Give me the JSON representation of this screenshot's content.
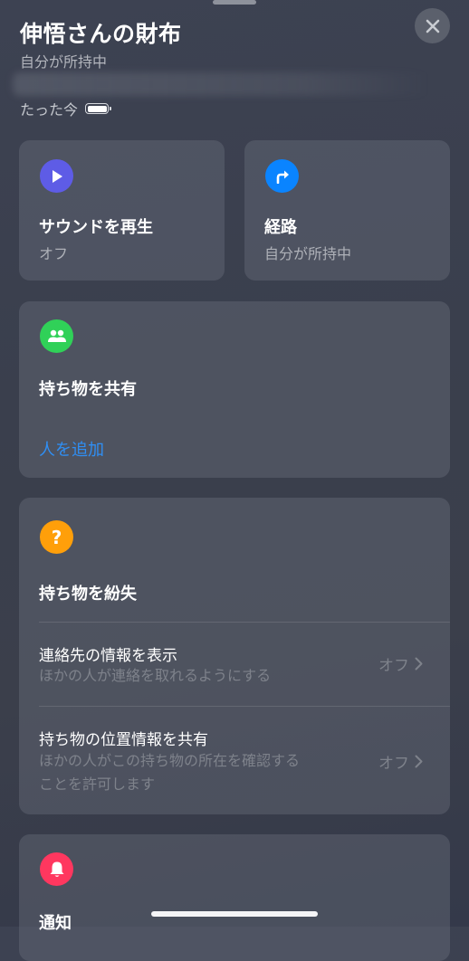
{
  "header": {
    "title": "伸悟さんの財布",
    "subtitle": "自分が所持中",
    "updated": "たった今"
  },
  "actions": {
    "play_sound": {
      "title": "サウンドを再生",
      "status": "オフ",
      "color": "#5e5ce6",
      "icon": "play-icon"
    },
    "directions": {
      "title": "経路",
      "status": "自分が所持中",
      "color": "#0a84ff",
      "icon": "directions-arrow-icon"
    }
  },
  "share": {
    "title": "持ち物を共有",
    "add_people": "人を追加",
    "color": "#30d158",
    "icon": "people-icon"
  },
  "lost": {
    "title": "持ち物を紛失",
    "color": "#ff9f0a",
    "icon": "question-icon",
    "rows": [
      {
        "title": "連絡先の情報を表示",
        "desc": "ほかの人が連絡を取れるようにする",
        "value": "オフ"
      },
      {
        "title": "持ち物の位置情報を共有",
        "desc_line1": "ほかの人がこの持ち物の所在を確認する",
        "desc_line2": "ことを許可します",
        "value": "オフ"
      }
    ]
  },
  "notifications": {
    "title": "通知",
    "color": "#ff375f",
    "icon": "bell-icon"
  }
}
